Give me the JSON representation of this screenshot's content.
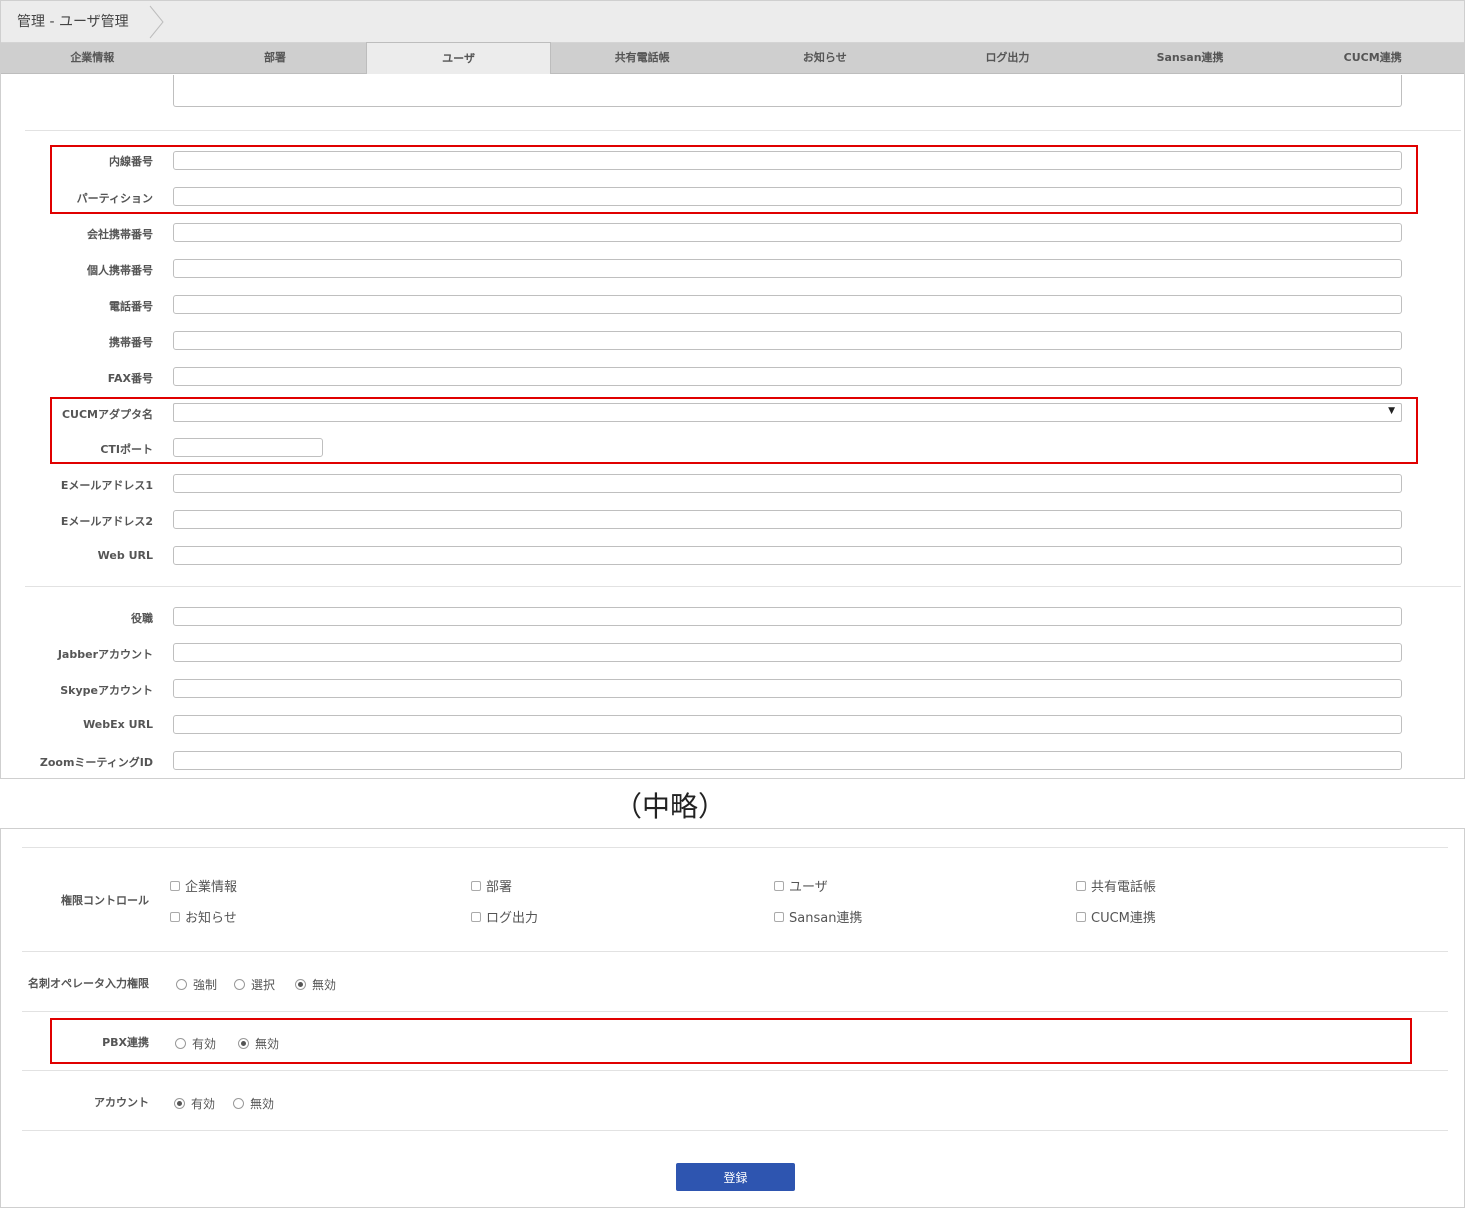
{
  "breadcrumb": "管理 - ユーザ管理",
  "tabs": [
    {
      "label": "企業情報",
      "active": false
    },
    {
      "label": "部署",
      "active": false
    },
    {
      "label": "ユーザ",
      "active": true
    },
    {
      "label": "共有電話帳",
      "active": false
    },
    {
      "label": "お知らせ",
      "active": false
    },
    {
      "label": "ログ出力",
      "active": false
    },
    {
      "label": "Sansan連携",
      "active": false
    },
    {
      "label": "CUCM連携",
      "active": false
    }
  ],
  "fields": {
    "extension": {
      "label": "内線番号",
      "value": ""
    },
    "partition": {
      "label": "パーティション",
      "value": ""
    },
    "company_mobile": {
      "label": "会社携帯番号",
      "value": ""
    },
    "personal_mobile": {
      "label": "個人携帯番号",
      "value": ""
    },
    "phone": {
      "label": "電話番号",
      "value": ""
    },
    "mobile": {
      "label": "携帯番号",
      "value": ""
    },
    "fax": {
      "label": "FAX番号",
      "value": ""
    },
    "cucm_adapter": {
      "label": "CUCMアダプタ名",
      "value": ""
    },
    "cti_port": {
      "label": "CTIポート",
      "value": ""
    },
    "email1": {
      "label": "Eメールアドレス1",
      "value": ""
    },
    "email2": {
      "label": "Eメールアドレス2",
      "value": ""
    },
    "web_url": {
      "label": "Web URL",
      "value": ""
    },
    "position": {
      "label": "役職",
      "value": ""
    },
    "jabber": {
      "label": "Jabberアカウント",
      "value": ""
    },
    "skype": {
      "label": "Skypeアカウント",
      "value": ""
    },
    "webex": {
      "label": "WebEx URL",
      "value": ""
    },
    "zoom": {
      "label": "ZoomミーティングID",
      "value": ""
    }
  },
  "omitted_note": "（中略）",
  "permissions": {
    "label": "権限コントロール",
    "items": [
      "企業情報",
      "部署",
      "ユーザ",
      "共有電話帳",
      "お知らせ",
      "ログ出力",
      "Sansan連携",
      "CUCM連携"
    ]
  },
  "card_operator": {
    "label": "名刺オペレータ入力権限",
    "options": [
      "強制",
      "選択",
      "無効"
    ],
    "selected": "無効"
  },
  "pbx": {
    "label": "PBX連携",
    "options": [
      "有効",
      "無効"
    ],
    "selected": "無効"
  },
  "account": {
    "label": "アカウント",
    "options": [
      "有効",
      "無効"
    ],
    "selected": "有効"
  },
  "submit_label": "登録",
  "colors": {
    "accent": "#2e55b0",
    "highlight": "#e00000"
  }
}
